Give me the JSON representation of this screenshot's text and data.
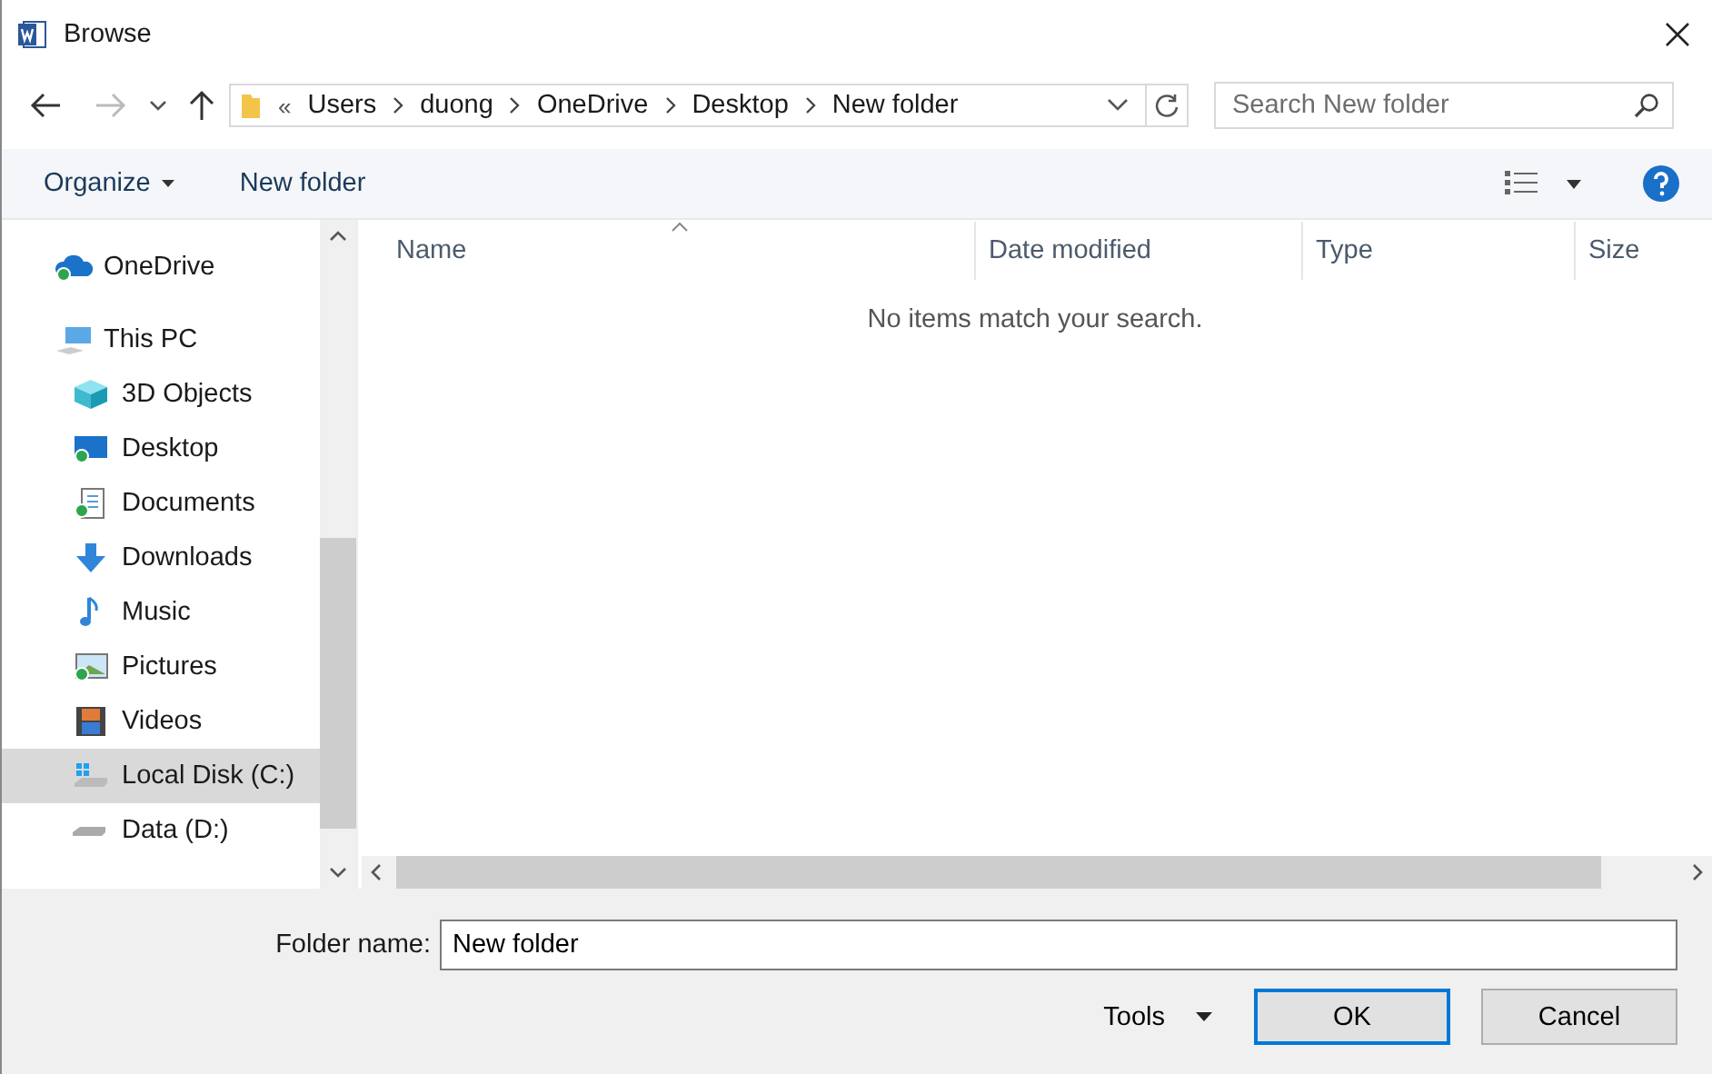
{
  "window": {
    "title": "Browse"
  },
  "address": {
    "overflow": "«",
    "crumbs": [
      "Users",
      "duong",
      "OneDrive",
      "Desktop",
      "New folder"
    ]
  },
  "search": {
    "placeholder": "Search New folder"
  },
  "toolbar": {
    "organize": "Organize",
    "new_folder": "New folder"
  },
  "sidebar": {
    "items": [
      {
        "label": "OneDrive",
        "kind": "cloud",
        "selected": false
      },
      {
        "label": "This PC",
        "kind": "pc",
        "selected": false,
        "children": [
          {
            "label": "3D Objects",
            "kind": "cube",
            "selected": false
          },
          {
            "label": "Desktop",
            "kind": "desktop",
            "selected": false
          },
          {
            "label": "Documents",
            "kind": "documents",
            "selected": false
          },
          {
            "label": "Downloads",
            "kind": "downloads",
            "selected": false
          },
          {
            "label": "Music",
            "kind": "music",
            "selected": false
          },
          {
            "label": "Pictures",
            "kind": "pictures",
            "selected": false
          },
          {
            "label": "Videos",
            "kind": "videos",
            "selected": false
          },
          {
            "label": "Local Disk (C:)",
            "kind": "sysdisk",
            "selected": true
          },
          {
            "label": "Data (D:)",
            "kind": "disk",
            "selected": false
          }
        ]
      }
    ]
  },
  "table": {
    "columns": [
      "Name",
      "Date modified",
      "Type",
      "Size"
    ],
    "empty_message": "No items match your search."
  },
  "footer": {
    "folder_label": "Folder name:",
    "folder_value": "New folder",
    "tools": "Tools",
    "ok": "OK",
    "cancel": "Cancel"
  }
}
